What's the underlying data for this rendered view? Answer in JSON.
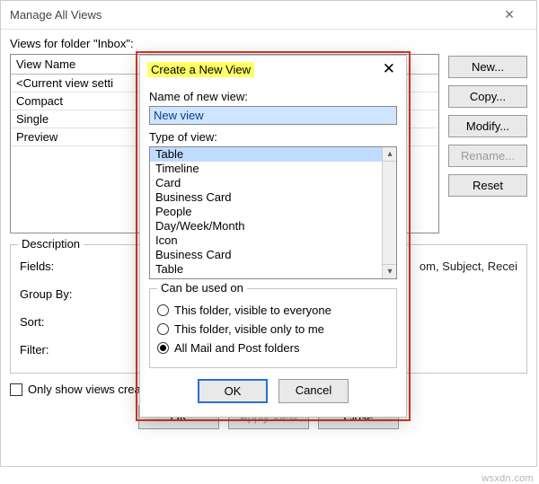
{
  "outer": {
    "title": "Manage All Views",
    "close_glyph": "×",
    "views_for_label": "Views for folder \"Inbox\":",
    "header_col1": "View Name",
    "rows": [
      "<Current view setti",
      "Compact",
      "Single",
      "Preview"
    ],
    "side_buttons": {
      "new": "New...",
      "copy": "Copy...",
      "modify": "Modify...",
      "rename": "Rename...",
      "reset": "Reset"
    },
    "description": {
      "legend": "Description",
      "fields_label": "Fields:",
      "fields_value": "om, Subject, Recei",
      "group_by_label": "Group By:",
      "sort_label": "Sort:",
      "filter_label": "Filter:"
    },
    "checkbox_label": "Only show views created for this folder",
    "bottom": {
      "ok": "OK",
      "apply": "Apply View",
      "close": "Close"
    }
  },
  "modal": {
    "title": "Create a New View",
    "close_glyph": "✕",
    "name_label": "Name of new view:",
    "name_value": "New view",
    "type_label": "Type of view:",
    "type_items": [
      "Table",
      "Timeline",
      "Card",
      "Business Card",
      "People",
      "Day/Week/Month",
      "Icon",
      "Business Card",
      "Table"
    ],
    "type_selected_index": 0,
    "usage": {
      "legend": "Can be used on",
      "options": [
        "This folder, visible to everyone",
        "This folder, visible only to me",
        "All Mail and Post folders"
      ],
      "selected_index": 2
    },
    "buttons": {
      "ok": "OK",
      "cancel": "Cancel"
    }
  },
  "watermark": "wsxdn.com"
}
